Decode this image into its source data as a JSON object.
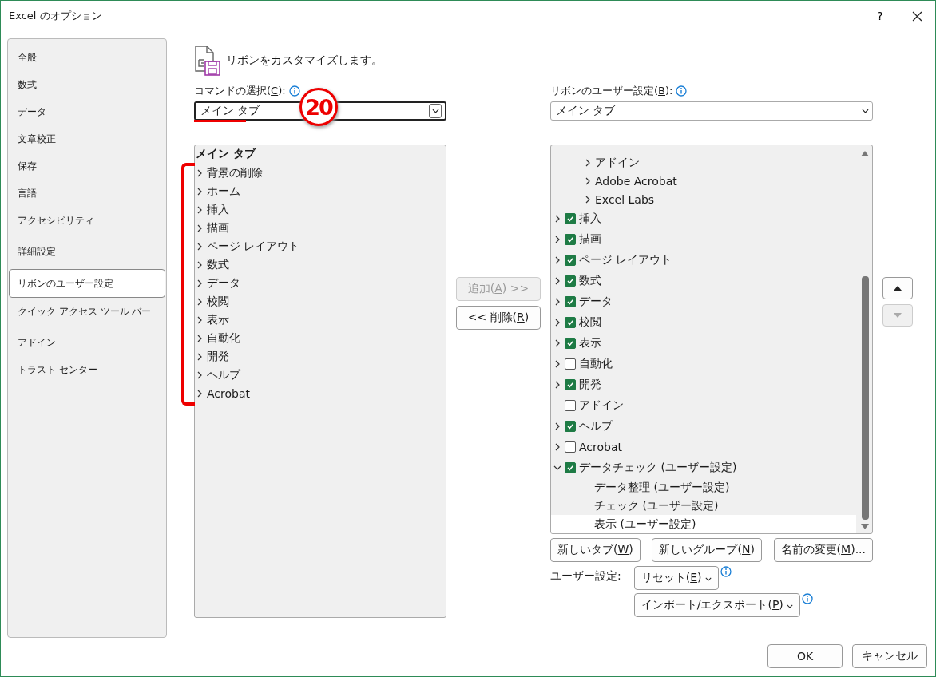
{
  "window": {
    "title": "Excel のオプション",
    "help": "?"
  },
  "sidebar": {
    "groups": [
      {
        "items": [
          {
            "label": "全般",
            "selected": false
          },
          {
            "label": "数式",
            "selected": false
          },
          {
            "label": "データ",
            "selected": false
          },
          {
            "label": "文章校正",
            "selected": false
          },
          {
            "label": "保存",
            "selected": false
          },
          {
            "label": "言語",
            "selected": false
          },
          {
            "label": "アクセシビリティ",
            "selected": false
          }
        ]
      },
      {
        "items": [
          {
            "label": "詳細設定",
            "selected": false
          }
        ]
      },
      {
        "items": [
          {
            "label": "リボンのユーザー設定",
            "selected": true
          },
          {
            "label": "クイック アクセス ツール バー",
            "selected": false
          }
        ]
      },
      {
        "items": [
          {
            "label": "アドイン",
            "selected": false
          },
          {
            "label": "トラスト センター",
            "selected": false
          }
        ]
      }
    ]
  },
  "heading": "リボンをカスタマイズします。",
  "commands": {
    "label": [
      "コマンドの選択(",
      "C",
      "):"
    ],
    "value": "メイン タブ",
    "badge": "20",
    "list_title": "メイン タブ",
    "items": [
      {
        "label": "背景の削除"
      },
      {
        "label": "ホーム"
      },
      {
        "label": "挿入"
      },
      {
        "label": "描画"
      },
      {
        "label": "ページ レイアウト"
      },
      {
        "label": "数式"
      },
      {
        "label": "データ"
      },
      {
        "label": "校閲"
      },
      {
        "label": "表示"
      },
      {
        "label": "自動化"
      },
      {
        "label": "開発"
      },
      {
        "label": "ヘルプ"
      },
      {
        "label": "Acrobat"
      }
    ]
  },
  "add_button": {
    "label": [
      "追加(",
      "A",
      ") >>"
    ],
    "disabled": true
  },
  "remove_button": {
    "label": [
      "<< 削除(",
      "R",
      ")"
    ],
    "disabled": false
  },
  "ribbon": {
    "label": [
      "リボンのユーザー設定(",
      "B",
      "):"
    ],
    "value": "メイン タブ",
    "group_items": [
      {
        "label": "アドイン"
      },
      {
        "label": "Adobe Acrobat"
      },
      {
        "label": "Excel Labs"
      }
    ],
    "tabs": [
      {
        "label": "挿入",
        "expandable": true,
        "expanded": false,
        "checked": true
      },
      {
        "label": "描画",
        "expandable": true,
        "expanded": false,
        "checked": true
      },
      {
        "label": "ページ レイアウト",
        "expandable": true,
        "expanded": false,
        "checked": true
      },
      {
        "label": "数式",
        "expandable": true,
        "expanded": false,
        "checked": true
      },
      {
        "label": "データ",
        "expandable": true,
        "expanded": false,
        "checked": true
      },
      {
        "label": "校閲",
        "expandable": true,
        "expanded": false,
        "checked": true
      },
      {
        "label": "表示",
        "expandable": true,
        "expanded": false,
        "checked": true
      },
      {
        "label": "自動化",
        "expandable": true,
        "expanded": false,
        "checked": false
      },
      {
        "label": "開発",
        "expandable": true,
        "expanded": false,
        "checked": true
      },
      {
        "label": "アドイン",
        "expandable": false,
        "checked": false
      },
      {
        "label": "ヘルプ",
        "expandable": true,
        "expanded": false,
        "checked": true
      },
      {
        "label": "Acrobat",
        "expandable": true,
        "expanded": false,
        "checked": false
      },
      {
        "label": "データチェック (ユーザー設定)",
        "expandable": true,
        "expanded": true,
        "checked": true,
        "children": [
          {
            "label": "データ整理 (ユーザー設定)",
            "selected": false
          },
          {
            "label": "チェック (ユーザー設定)",
            "selected": false
          },
          {
            "label": "表示 (ユーザー設定)",
            "selected": true
          }
        ]
      }
    ]
  },
  "up_button": {
    "disabled": false
  },
  "down_button": {
    "disabled": true
  },
  "tab_buttons": [
    {
      "label": [
        "新しいタブ(",
        "W",
        ")"
      ]
    },
    {
      "label": [
        "新しいグループ(",
        "N",
        ")"
      ]
    },
    {
      "label": [
        "名前の変更(",
        "M",
        ")..."
      ]
    }
  ],
  "customize": {
    "label": "ユーザー設定:",
    "reset": [
      "リセット(",
      "E",
      ")"
    ],
    "import_export": [
      "インポート/エクスポート(",
      "P",
      ")"
    ]
  },
  "footer": {
    "ok": "OK",
    "cancel": "キャンセル"
  }
}
